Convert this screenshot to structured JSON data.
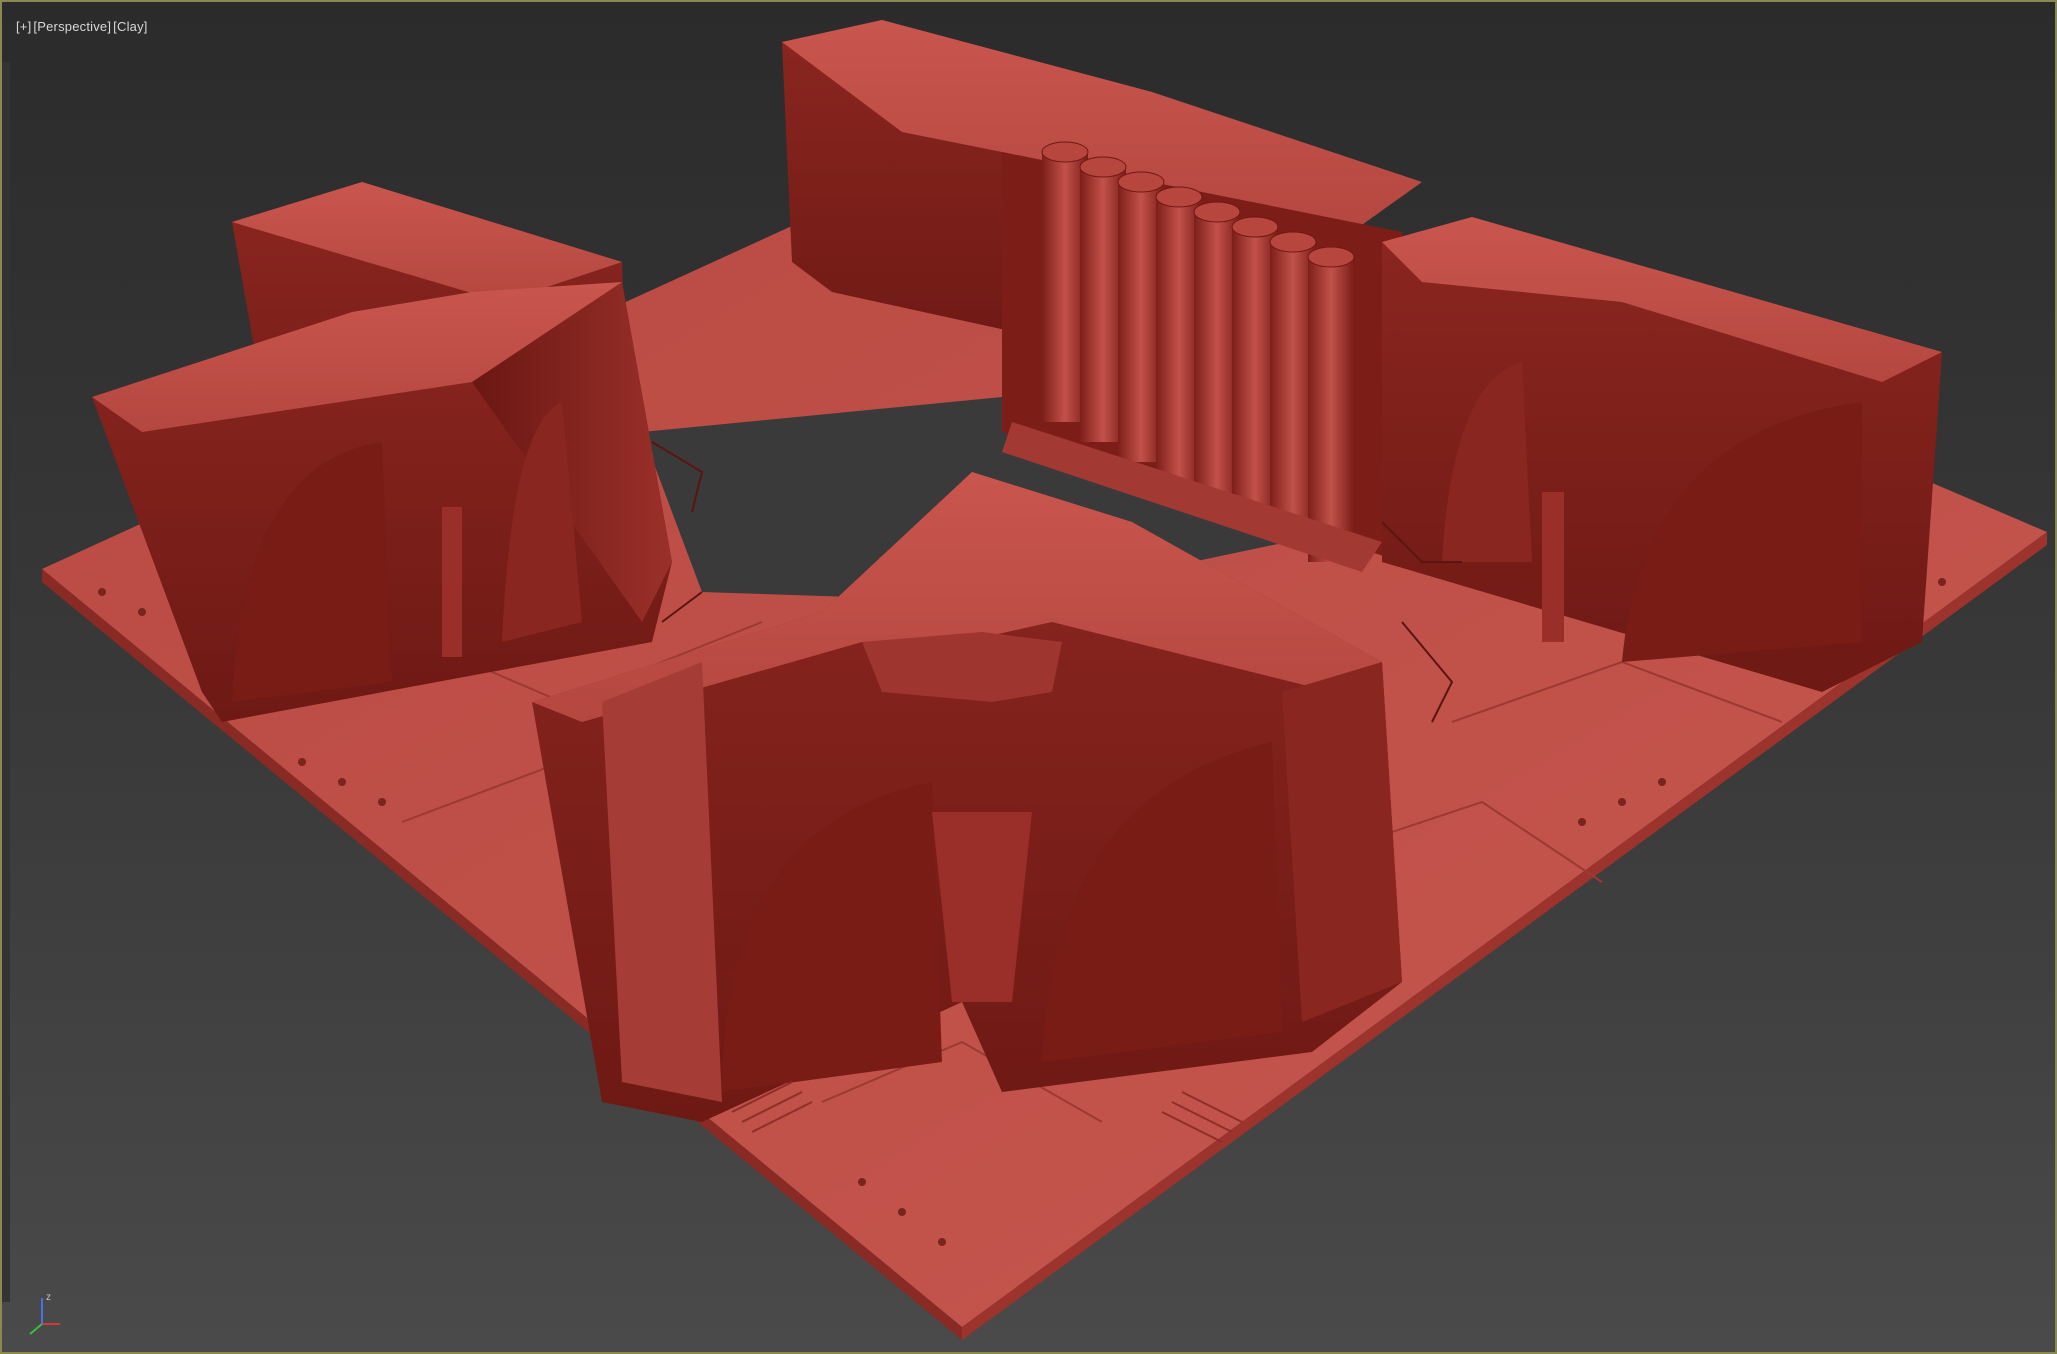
{
  "viewport": {
    "label_parts": [
      "[+]",
      "[Perspective]",
      "[Clay]"
    ],
    "background_top": "#2b2b2b",
    "background_bottom": "#4a4a4a",
    "border_color": "#8a8a50"
  },
  "model": {
    "clay_color": "#c0514a",
    "clay_dark": "#7a1f1a",
    "clay_mid": "#a8403a"
  },
  "gizmo": {
    "axes": [
      "x",
      "y",
      "z"
    ],
    "z_label": "z"
  },
  "icons": [
    "axis-gizmo-icon"
  ]
}
